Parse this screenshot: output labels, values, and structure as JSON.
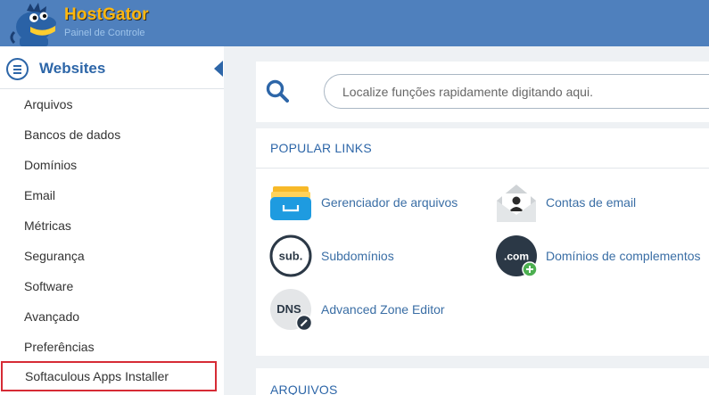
{
  "header": {
    "brand": "HostGator",
    "subtitle": "Painel de Controle",
    "brand_color": "#ffb70f",
    "bar_color": "#4f80bd"
  },
  "sidebar": {
    "title": "Websites",
    "icon": "list-icon",
    "items": [
      {
        "label": "Arquivos"
      },
      {
        "label": "Bancos de dados"
      },
      {
        "label": "Domínios"
      },
      {
        "label": "Email"
      },
      {
        "label": "Métricas"
      },
      {
        "label": "Segurança"
      },
      {
        "label": "Software"
      },
      {
        "label": "Avançado"
      },
      {
        "label": "Preferências"
      },
      {
        "label": "Softaculous Apps Installer",
        "highlighted": true
      }
    ]
  },
  "search": {
    "placeholder": "Localize funções rapidamente digitando aqui.",
    "value": ""
  },
  "popular_links": {
    "title": "POPULAR LINKS",
    "items": [
      {
        "label": "Gerenciador de arquivos",
        "icon": "file-manager-icon"
      },
      {
        "label": "Contas de email",
        "icon": "email-accounts-icon"
      },
      {
        "label": "Subdomínios",
        "icon": "subdomains-icon",
        "icon_text": "sub."
      },
      {
        "label": "Domínios de complementos",
        "icon": "addon-domains-icon",
        "icon_text": ".com"
      },
      {
        "label": "Advanced Zone Editor",
        "icon": "dns-icon",
        "icon_text": "DNS"
      }
    ]
  },
  "arquivos_section": {
    "title": "ARQUIVOS"
  },
  "colors": {
    "accent": "#2d66a8",
    "highlight_border": "#d62b35"
  }
}
